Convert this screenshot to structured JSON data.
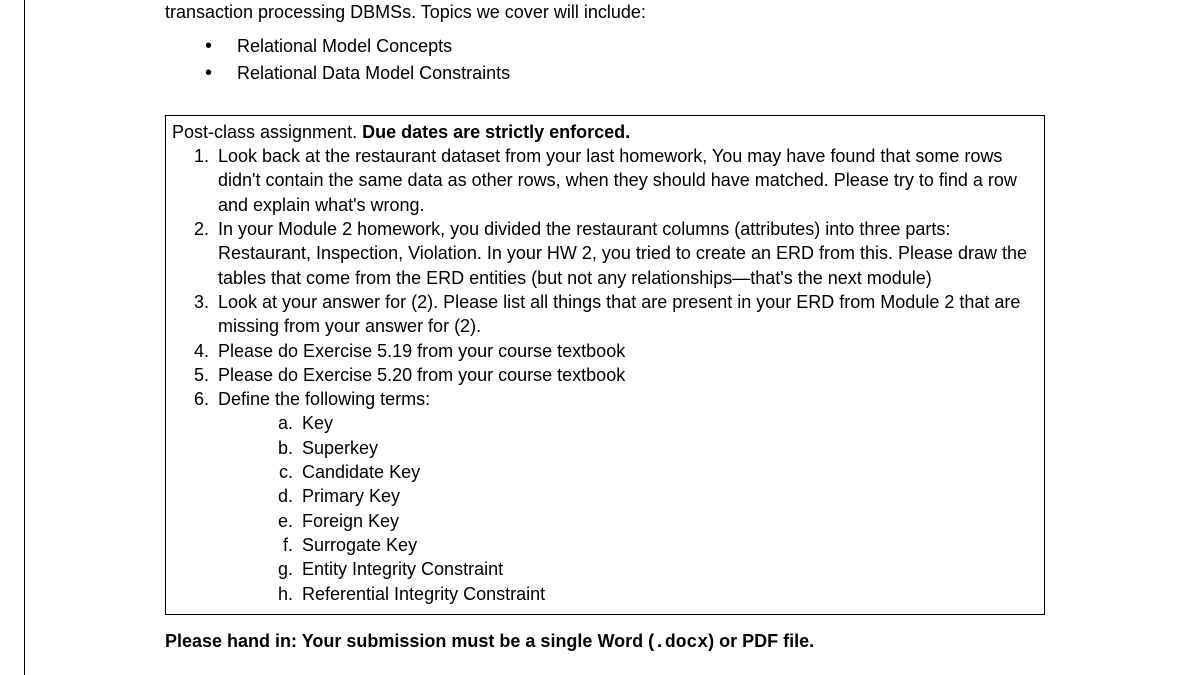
{
  "intro": {
    "lead": "transaction processing DBMSs. Topics we cover will include:",
    "bullets": [
      "Relational Model Concepts",
      "Relational Data Model Constraints"
    ]
  },
  "box": {
    "header_plain": "Post-class assignment. ",
    "header_bold": "Due dates are strictly enforced.",
    "items": [
      "Look back at the restaurant dataset from your last homework, You may have found that some rows didn't contain the same data as other rows, when they should have matched. Please try to find a row and explain what's wrong.",
      "In your Module 2 homework, you divided the restaurant columns (attributes) into three parts: Restaurant, Inspection, Violation. In your HW 2, you tried to create an ERD from this. Please draw the tables that come from the ERD entities (but not any relationships—that's the next module)",
      "Look at your answer for (2). Please list all things that are present in your ERD from Module 2 that are missing from your answer for (2).",
      "Please do Exercise 5.19 from your course textbook",
      "Please do Exercise 5.20 from your course textbook",
      "Define the following terms:"
    ],
    "terms": [
      "Key",
      "Superkey",
      "Candidate Key",
      "Primary Key",
      "Foreign Key",
      "Surrogate Key",
      "Entity Integrity Constraint",
      "Referential Integrity Constraint"
    ]
  },
  "handin": {
    "label": "Please hand in:  ",
    "text_before": "Your submission must be a single Word (",
    "code": ".docx",
    "text_after": ") or PDF file."
  }
}
